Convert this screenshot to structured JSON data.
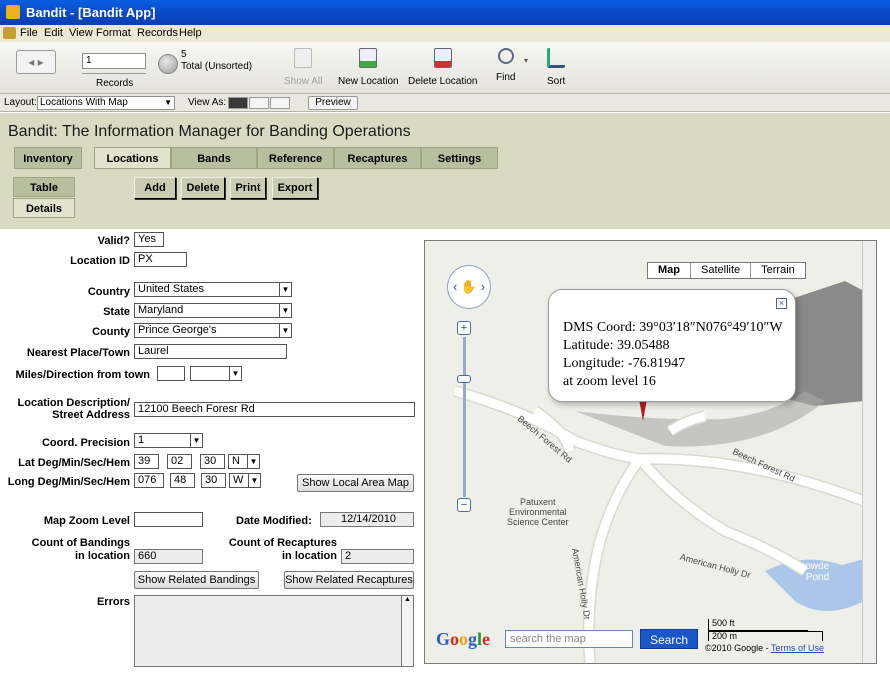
{
  "window": {
    "title": "Bandit - [Bandit App]"
  },
  "menu": [
    "File",
    "Edit",
    "View",
    "Format",
    "Records",
    "Help"
  ],
  "toolbar": {
    "record_number": "1",
    "records_label": "Records",
    "total_count": "5",
    "total_label": "Total (Unsorted)",
    "show_all": "Show All",
    "new_location": "New Location",
    "delete_location": "Delete Location",
    "find": "Find",
    "sort": "Sort"
  },
  "layoutbar": {
    "layout_label": "Layout:",
    "layout_value": "Locations With Map",
    "view_as_label": "View As:",
    "preview": "Preview"
  },
  "header": {
    "title": "Bandit: The Information Manager for Banding Operations",
    "tabs": [
      "Inventory",
      "Locations",
      "Bands",
      "Reference",
      "Recaptures",
      "Settings"
    ],
    "active_tab": "Locations",
    "subtabs": [
      "Table",
      "Details"
    ],
    "active_subtab": "Details",
    "actions": [
      "Add",
      "Delete",
      "Print",
      "Export"
    ]
  },
  "form": {
    "valid_label": "Valid?",
    "valid_value": "Yes",
    "location_id_label": "Location ID",
    "location_id_value": "PX",
    "country_label": "Country",
    "country_value": "United States",
    "state_label": "State",
    "state_value": "Maryland",
    "county_label": "County",
    "county_value": "Prince George's",
    "nearest_label": "Nearest Place/Town",
    "nearest_value": "Laurel",
    "miles_label": "Miles/Direction from town",
    "miles_value": "",
    "direction_value": "",
    "desc_label_1": "Location Description/",
    "desc_label_2": "Street Address",
    "desc_value": "12100 Beech Foresr Rd",
    "coord_precision_label": "Coord. Precision",
    "coord_precision_value": "1",
    "lat_label": "Lat Deg/Min/Sec/Hem",
    "lat_deg": "39",
    "lat_min": "02",
    "lat_sec": "30",
    "lat_hem": "N",
    "long_label": "Long Deg/Min/Sec/Hem",
    "long_deg": "076",
    "long_min": "48",
    "long_sec": "30",
    "long_hem": "W",
    "show_local_map": "Show Local Area Map",
    "map_zoom_label": "Map Zoom Level",
    "map_zoom_value": "",
    "date_modified_label": "Date Modified:",
    "date_modified_value": "12/14/2010",
    "count_bandings_label_1": "Count of Bandings",
    "count_bandings_label_2": "in location",
    "count_bandings_value": "660",
    "count_recaptures_label_1": "Count of Recaptures",
    "count_recaptures_label_2": "in location",
    "count_recaptures_value": "2",
    "show_related_bandings": "Show Related Bandings",
    "show_related_recaptures": "Show Related Recaptures",
    "errors_label": "Errors",
    "errors_value": ""
  },
  "map": {
    "type_buttons": [
      "Map",
      "Satellite",
      "Terrain"
    ],
    "active_type": "Map",
    "info": {
      "dms": "DMS Coord: 39°03′18″N076°49′10″W",
      "latitude": "Latitude: 39.05488",
      "longitude": "Longitude: -76.81947",
      "zoom": "at zoom level 16"
    },
    "road_labels": [
      "Beech Forest Rd",
      "Beech Forest Rd",
      "American Holly Dr",
      "American Holly Dr"
    ],
    "poi": [
      "Patuxent",
      "Environmental",
      "Science Center"
    ],
    "pond": [
      "Snowde",
      "Pond"
    ],
    "google": "Google",
    "search_placeholder": "search the map",
    "search_button": "Search",
    "scale_ft": "500 ft",
    "scale_m": "200 m",
    "copyright": "©2010 Google - ",
    "terms": "Terms of Use"
  },
  "colors": {
    "titlebar": "#0a4fd0",
    "header_band": "#d8dac2",
    "tab": "#b8bea0",
    "tab_active": "#e1e3cc",
    "water": "#aac6e8",
    "marker": "#c0181c"
  }
}
